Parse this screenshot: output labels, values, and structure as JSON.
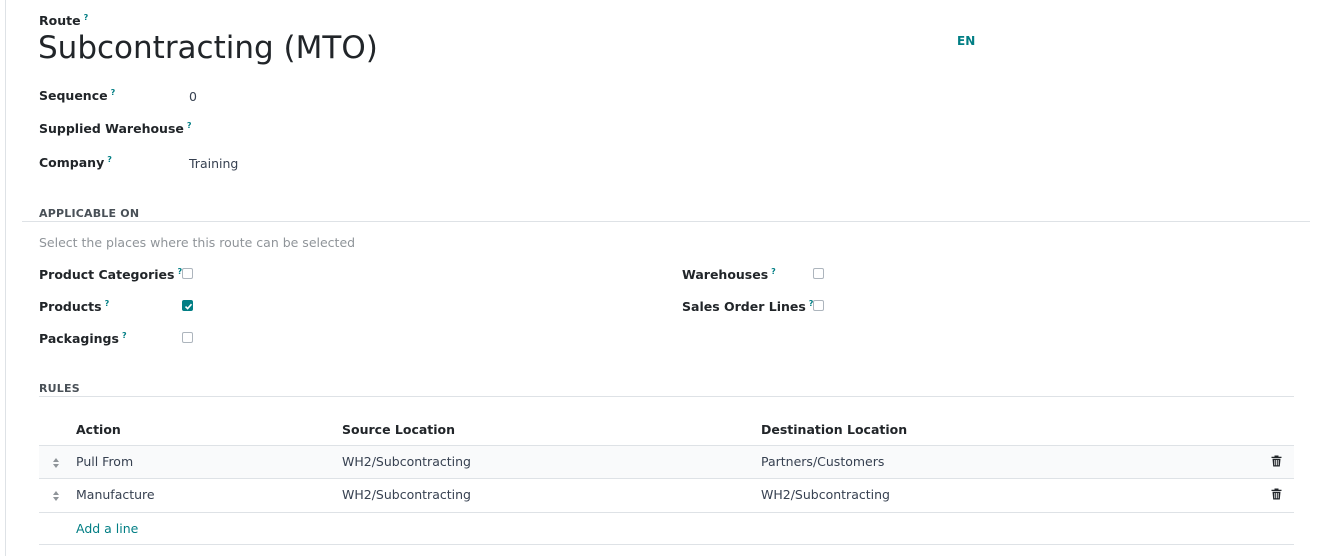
{
  "form": {
    "route_label": "Route",
    "title": "Subcontracting (MTO)",
    "lang": "EN",
    "help_mark": "?",
    "fields": {
      "sequence_label": "Sequence",
      "sequence_value": "0",
      "warehouse_label": "Supplied Warehouse",
      "warehouse_value": "",
      "company_label": "Company",
      "company_value": "Training"
    }
  },
  "applicable": {
    "heading": "APPLICABLE ON",
    "hint": "Select the places where this route can be selected",
    "product_categories": {
      "label": "Product Categories",
      "checked": false
    },
    "products": {
      "label": "Products",
      "checked": true
    },
    "packagings": {
      "label": "Packagings",
      "checked": false
    },
    "warehouses": {
      "label": "Warehouses",
      "checked": false
    },
    "sales_order_lines": {
      "label": "Sales Order Lines",
      "checked": false
    }
  },
  "rules": {
    "heading": "RULES",
    "columns": [
      "Action",
      "Source Location",
      "Destination Location"
    ],
    "rows": [
      {
        "action": "Pull From",
        "source": "WH2/Subcontracting",
        "destination": "Partners/Customers"
      },
      {
        "action": "Manufacture",
        "source": "WH2/Subcontracting",
        "destination": "WH2/Subcontracting"
      }
    ],
    "add_line": "Add a line"
  },
  "colors": {
    "accent": "#017e84",
    "border": "#dee2e6",
    "muted": "#8f9499"
  },
  "icons": [
    "drag-handle-icon",
    "trash-icon",
    "check-icon"
  ]
}
